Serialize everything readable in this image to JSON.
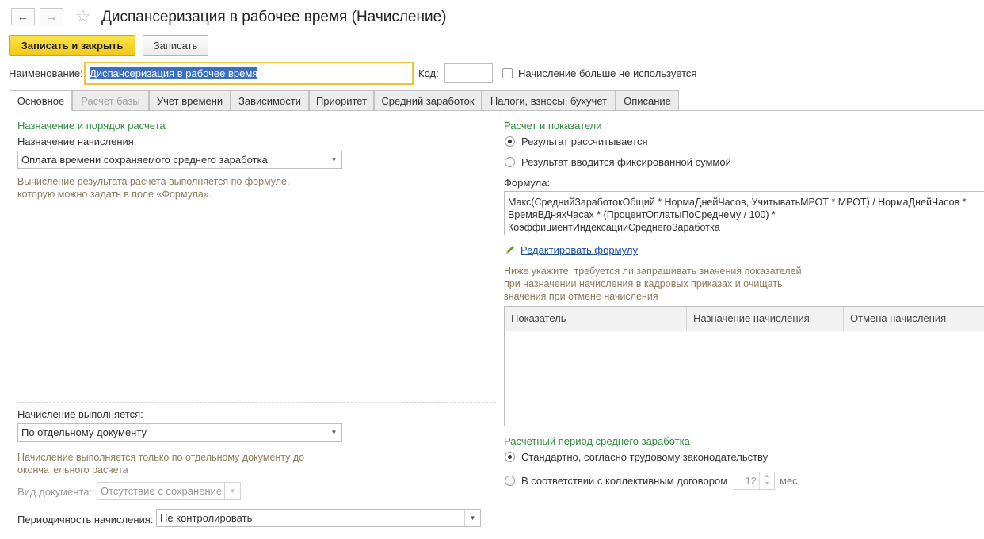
{
  "window": {
    "title": "Диспансеризация в рабочее время (Начисление)"
  },
  "toolbar": {
    "save_close_label": "Записать и закрыть",
    "save_label": "Записать"
  },
  "header": {
    "name_label": "Наименование:",
    "name_value": "Диспансеризация в рабочее время",
    "code_label": "Код:",
    "code_value": "",
    "not_used_label": "Начисление больше не используется"
  },
  "tabs": [
    {
      "label": "Основное"
    },
    {
      "label": "Расчет базы"
    },
    {
      "label": "Учет времени"
    },
    {
      "label": "Зависимости"
    },
    {
      "label": "Приоритет"
    },
    {
      "label": "Средний заработок"
    },
    {
      "label": "Налоги, взносы, бухучет"
    },
    {
      "label": "Описание"
    }
  ],
  "left": {
    "section_title": "Назначение и порядок расчета",
    "purpose_label": "Назначение начисления:",
    "purpose_value": "Оплата времени сохраняемого среднего заработка",
    "purpose_hint_1": "Вычисление результата расчета выполняется по формуле,",
    "purpose_hint_2": "которую можно задать в поле «Формула».",
    "executed_label": "Начисление выполняется:",
    "executed_value": "По отдельному документу",
    "executed_hint_1": "Начисление выполняется только по отдельному документу до",
    "executed_hint_2": "окончательного расчета",
    "doc_type_label": "Вид документа:",
    "doc_type_value": "Отсутствие с сохранение",
    "periodicity_label": "Периодичность начисления:",
    "periodicity_value": "Не контролировать"
  },
  "right": {
    "section_title": "Расчет и показатели",
    "radio_calculated": "Результат рассчитывается",
    "radio_fixed": "Результат вводится фиксированной суммой",
    "formula_label": "Формула:",
    "formula_line_1": "Макс(СреднийЗаработокОбщий * НормаДнейЧасов, УчитыватьМРОТ * МРОТ) / НормаДнейЧасов *",
    "formula_line_2": "ВремяВДняхЧасах * (ПроцентОплатыПоСреднему / 100) *",
    "formula_line_3": "КоэффициентИндексацииСреднегоЗаработка",
    "edit_formula_label": "Редактировать формулу",
    "indicators_hint_1": "Ниже укажите, требуется ли запрашивать значения показателей",
    "indicators_hint_2": "при назначении начисления в кадровых приказах и очищать",
    "indicators_hint_3": "значения при отмене начисления",
    "table_columns": [
      "Показатель",
      "Назначение начисления",
      "Отмена начисления"
    ],
    "period_title": "Расчетный период среднего заработка",
    "radio_standard": "Стандартно, согласно трудовому законодательству",
    "radio_collective": "В соответствии с коллективным договором",
    "months_value": "12",
    "months_unit": "мес."
  },
  "colors": {
    "accent_yellow": "#f5d21f",
    "section_green": "#2e8b3f",
    "hint_brown": "#8c7a5a",
    "link_blue": "#1a4fa0"
  }
}
